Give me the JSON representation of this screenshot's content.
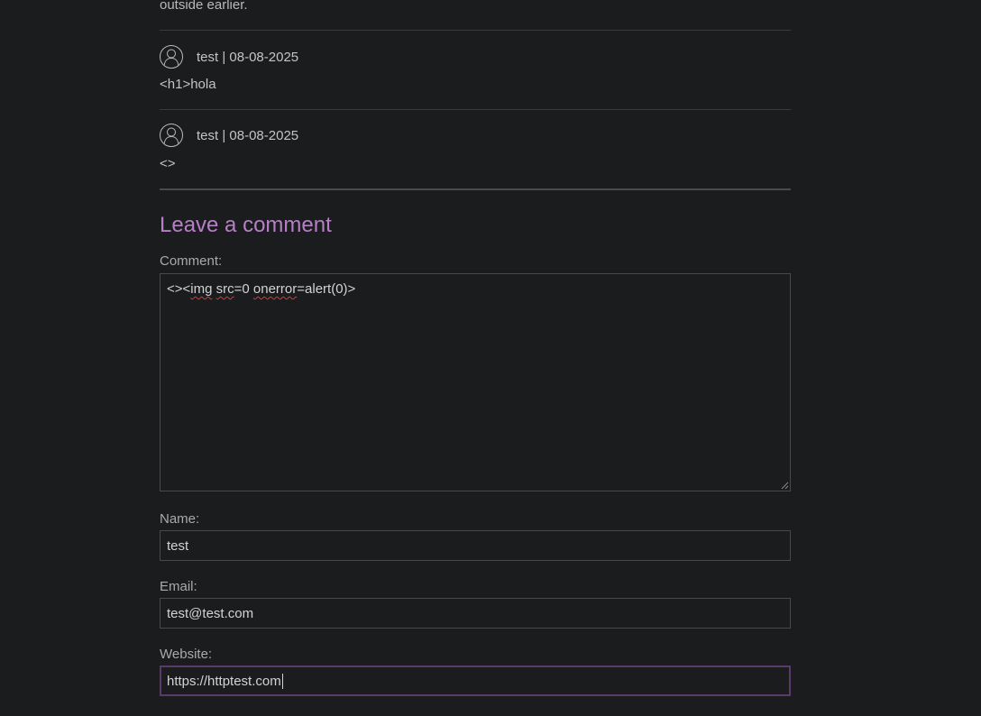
{
  "previous_comment": {
    "text_tail": "outside earlier."
  },
  "comments": [
    {
      "author_date": "test | 08-08-2025",
      "body": "<h1>hola"
    },
    {
      "author_date": "test | 08-08-2025",
      "body": "<>"
    }
  ],
  "form": {
    "title": "Leave a comment",
    "comment_label": "Comment:",
    "comment_value_parts": [
      "<><",
      "img",
      " ",
      "src",
      "=0 ",
      "onerror",
      "=alert(0)>"
    ],
    "name_label": "Name:",
    "name_value": "test",
    "email_label": "Email:",
    "email_value": "test@test.com",
    "website_label": "Website:",
    "website_value": "https://httptest.com"
  },
  "colors": {
    "background": "#1b1c1e",
    "accent": "#b77fc6",
    "focus_border": "#5b3a6b",
    "spellcheck": "#d13b3b"
  },
  "icons": {
    "avatar": "user-avatar-icon"
  }
}
